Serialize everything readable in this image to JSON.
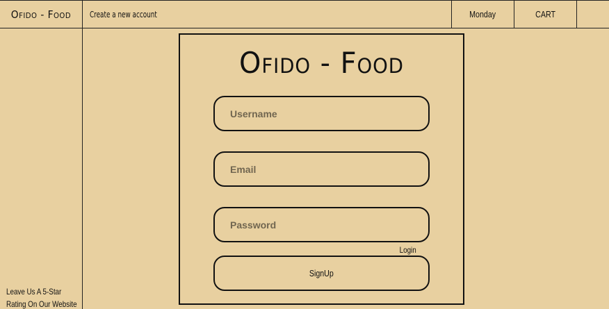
{
  "header": {
    "brand": "Ofido - Food",
    "create_account": "Create a new account",
    "day": "Monday",
    "cart": "CART"
  },
  "sidebar": {
    "rating_line1": "Leave Us A 5-Star",
    "rating_line2": "Rating On Our Website"
  },
  "signup": {
    "title": "Ofido - Food",
    "username_placeholder": "Username",
    "email_placeholder": "Email",
    "password_placeholder": "Password",
    "login_label": "Login",
    "signup_label": "SignUp"
  },
  "colors": {
    "background": "#e8d0a0",
    "border": "#111111"
  }
}
